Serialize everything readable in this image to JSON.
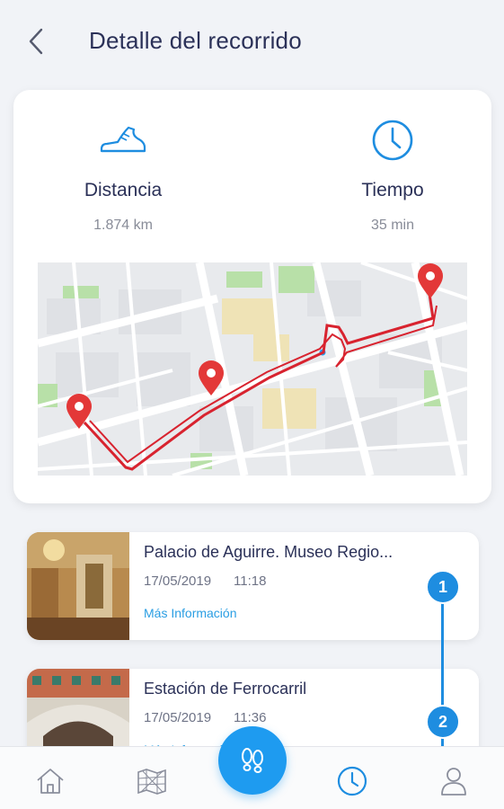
{
  "header": {
    "title": "Detalle del recorrido"
  },
  "summary": {
    "distance_label": "Distancia",
    "distance_value": "1.874 km",
    "time_label": "Tiempo",
    "time_value": "35 min"
  },
  "stops": [
    {
      "name": "Palacio de Aguirre. Museo Regio...",
      "date": "17/05/2019",
      "time": "11:18",
      "more": "Más Información",
      "step": "1"
    },
    {
      "name": "Estación de Ferrocarril",
      "date": "17/05/2019",
      "time": "11:36",
      "more": "Más Información",
      "step": "2"
    }
  ],
  "colors": {
    "accent": "#1e8de0",
    "route": "#d8232f",
    "title": "#2b3158"
  },
  "icons": {
    "back": "chevron-left-icon",
    "shoe": "shoe-icon",
    "clock": "clock-icon",
    "home": "home-icon",
    "map": "map-icon",
    "footsteps": "footsteps-icon",
    "history": "history-icon",
    "profile": "profile-icon"
  }
}
